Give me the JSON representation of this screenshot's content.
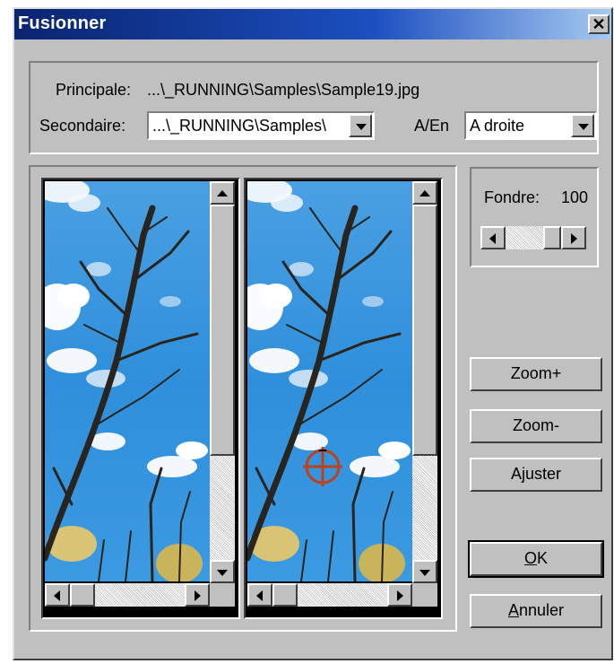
{
  "window": {
    "title": "Fusionner",
    "close_glyph": "✕"
  },
  "principale": {
    "label": "Principale:",
    "value": "...\\_RUNNING\\Samples\\Sample19.jpg"
  },
  "secondaire": {
    "label": "Secondaire:",
    "value": "...\\_RUNNING\\Samples\\"
  },
  "position": {
    "label": "A/En",
    "value": "A droite"
  },
  "fondre": {
    "label": "Fondre:",
    "value": "100"
  },
  "buttons": {
    "zoom_in": "Zoom+",
    "zoom_out": "Zoom-",
    "fit": "Ajuster",
    "ok_mnemonic": "O",
    "ok_rest": "K",
    "cancel_mnemonic": "A",
    "cancel_rest": "nnuler"
  },
  "icons": {
    "close": "close-icon",
    "dropdown": "chevron-down-icon",
    "scroll_up": "arrow-up-icon",
    "scroll_down": "arrow-down-icon",
    "scroll_left": "arrow-left-icon",
    "scroll_right": "arrow-right-icon",
    "crosshair": "crosshair-icon"
  },
  "colors": {
    "titlebar_start": "#0a2470",
    "dialog_face": "#c0c0c0",
    "sky": "#3a95de",
    "crosshair": "#c0401a"
  }
}
